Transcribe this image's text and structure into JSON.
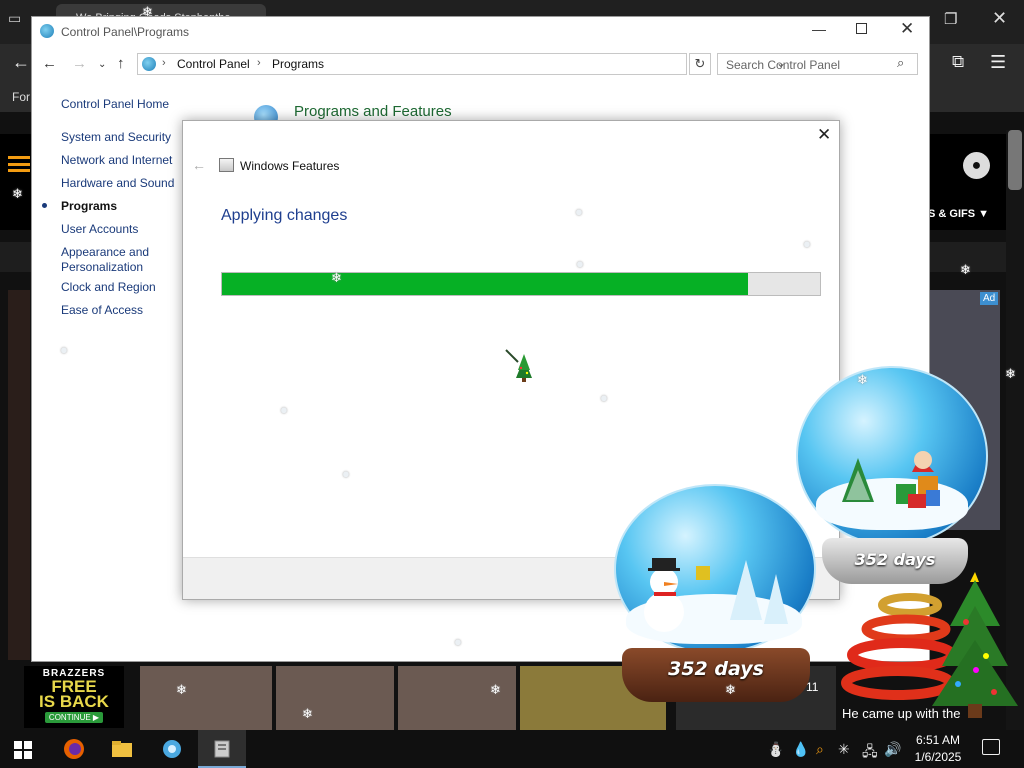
{
  "browser": {
    "tab_title": "We Bringing Goods Stephenthe",
    "bookmark_label": "For",
    "nav_category": "S & GIFS ▼",
    "ad_badge": "Ad",
    "promo": {
      "brand": "BRAZZERS",
      "headline_1": "FREE",
      "headline_2": "IS BACK",
      "button": "CONTINUE ▶"
    },
    "thumb_count": "11",
    "caption": "He came up with the"
  },
  "control_panel": {
    "title": "Control Panel\\Programs",
    "breadcrumb": [
      "Control Panel",
      "Programs"
    ],
    "search_placeholder": "Search Control Panel",
    "sidebar": [
      {
        "label": "Control Panel Home",
        "active": false
      },
      {
        "label": "System and Security",
        "active": false
      },
      {
        "label": "Network and Internet",
        "active": false
      },
      {
        "label": "Hardware and Sound",
        "active": false
      },
      {
        "label": "Programs",
        "active": true
      },
      {
        "label": "User Accounts",
        "active": false
      },
      {
        "label": "Appearance and",
        "active": false
      },
      {
        "label": "Personalization",
        "active": false
      },
      {
        "label": "Clock and Region",
        "active": false
      },
      {
        "label": "Ease of Access",
        "active": false
      }
    ],
    "section_title": "Programs and Features"
  },
  "windows_features": {
    "title": "Windows Features",
    "heading": "Applying changes",
    "progress_fraction": 0.88
  },
  "overlay": {
    "globe_large_text": "352 days",
    "globe_small_text": "352 days"
  },
  "taskbar": {
    "apps": [
      "firefox-icon",
      "file-explorer-icon",
      "control-panel-icon",
      "windows-features-icon"
    ],
    "time": "6:51 AM",
    "date": "1/6/2025"
  },
  "colors": {
    "progress_fill": "#06b025",
    "progress_track": "#e6e6e6",
    "heading_blue": "#1f3f8f",
    "section_green": "#1e6a33"
  }
}
